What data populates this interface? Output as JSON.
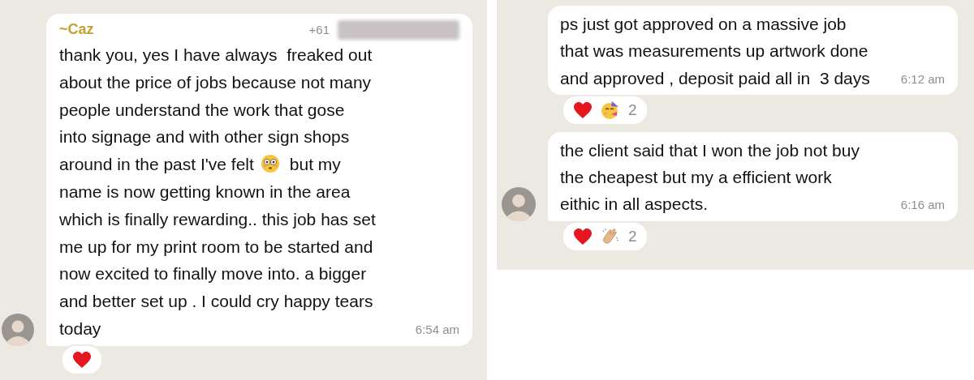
{
  "panels": [
    {
      "messages": [
        {
          "avatar": true,
          "sender": "~Caz",
          "phone": "+61",
          "redacted": true,
          "lines": [
            [
              {
                "kind": "text",
                "text": "thank you, yes I have always  freaked out"
              }
            ],
            [
              {
                "kind": "text",
                "text": "about the price of jobs because not many"
              }
            ],
            [
              {
                "kind": "text",
                "text": "people understand the work that gose"
              }
            ],
            [
              {
                "kind": "text",
                "text": "into signage and with other sign shops"
              }
            ],
            [
              {
                "kind": "text",
                "text": "around in the past I've felt"
              },
              {
                "kind": "flushed"
              },
              {
                "kind": "text",
                "text": "but my"
              }
            ],
            [
              {
                "kind": "text",
                "text": "name is now getting known in the area"
              }
            ],
            [
              {
                "kind": "text",
                "text": "which is finally rewarding.. this job has set"
              }
            ],
            [
              {
                "kind": "text",
                "text": "me up for my print room to be started and"
              }
            ],
            [
              {
                "kind": "text",
                "text": "now excited to finally move into. a bigger"
              }
            ],
            [
              {
                "kind": "text",
                "text": "and better set up . I could cry happy tears"
              }
            ],
            [
              {
                "kind": "text",
                "text": "today"
              }
            ]
          ],
          "time": "6:54 am",
          "reactions": [
            {
              "kind": "heart"
            }
          ]
        }
      ]
    },
    {
      "messages": [
        {
          "avatar": false,
          "lines": [
            [
              {
                "kind": "text",
                "text": "ps just got approved on a massive job"
              }
            ],
            [
              {
                "kind": "text",
                "text": "that was measurements up artwork done"
              }
            ],
            [
              {
                "kind": "text",
                "text": "and approved , deposit paid all in  3 days"
              }
            ]
          ],
          "time": "6:12 am",
          "reactions": [
            {
              "kind": "heart"
            },
            {
              "kind": "party"
            }
          ],
          "reaction_count": "2"
        },
        {
          "avatar": true,
          "lines": [
            [
              {
                "kind": "text",
                "text": "the client said that I won the job not buy"
              }
            ],
            [
              {
                "kind": "text",
                "text": "the cheapest but my a efficient work"
              }
            ],
            [
              {
                "kind": "text",
                "text": "eithic in all aspects."
              }
            ]
          ],
          "time": "6:16 am",
          "reactions": [
            {
              "kind": "heart"
            },
            {
              "kind": "clap"
            }
          ],
          "reaction_count": "2"
        }
      ]
    }
  ]
}
